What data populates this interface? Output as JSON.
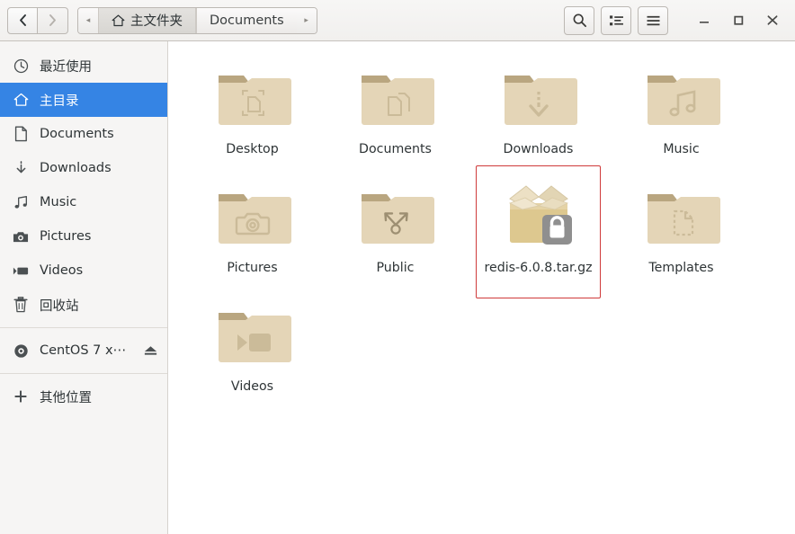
{
  "window": {
    "title": "Documents"
  },
  "header": {
    "nav": {
      "back_label": "‹",
      "back_name": "back-button",
      "forward_label": "›",
      "forward_name": "forward-button"
    },
    "breadcrumb": {
      "left_arrow": "◂",
      "right_arrow": "▸",
      "items": [
        {
          "label": "主文件夹",
          "icon": "home-icon",
          "active": true
        },
        {
          "label": "Documents",
          "icon": "",
          "active": false
        }
      ]
    },
    "tools": [
      {
        "name": "search-button",
        "icon": "search-icon",
        "label": ""
      },
      {
        "name": "view-list-button",
        "icon": "list-view-icon",
        "label": ""
      },
      {
        "name": "main-menu-button",
        "icon": "hamburger-icon",
        "label": ""
      }
    ],
    "window_controls": [
      {
        "name": "minimize-button",
        "icon": "minimize-icon",
        "label": "–"
      },
      {
        "name": "maximize-button",
        "icon": "maximize-icon",
        "label": "□"
      },
      {
        "name": "close-button",
        "icon": "close-icon",
        "label": "×"
      }
    ]
  },
  "sidebar": {
    "items": [
      {
        "label": "最近使用",
        "icon": "clock-icon",
        "name": "sidebar-item-recent",
        "selected": false,
        "eject": false
      },
      {
        "label": "主目录",
        "icon": "home-icon",
        "name": "sidebar-item-home",
        "selected": true,
        "eject": false
      },
      {
        "label": "Documents",
        "icon": "document-icon",
        "name": "sidebar-item-documents",
        "selected": false,
        "eject": false
      },
      {
        "label": "Downloads",
        "icon": "download-icon",
        "name": "sidebar-item-downloads",
        "selected": false,
        "eject": false
      },
      {
        "label": "Music",
        "icon": "music-icon",
        "name": "sidebar-item-music",
        "selected": false,
        "eject": false
      },
      {
        "label": "Pictures",
        "icon": "camera-icon",
        "name": "sidebar-item-pictures",
        "selected": false,
        "eject": false
      },
      {
        "label": "Videos",
        "icon": "video-icon",
        "name": "sidebar-item-videos",
        "selected": false,
        "eject": false
      },
      {
        "label": "回收站",
        "icon": "trash-icon",
        "name": "sidebar-item-trash",
        "selected": false,
        "eject": false
      },
      {
        "separator": true
      },
      {
        "label": "CentOS 7 x⋯",
        "icon": "disc-icon",
        "name": "sidebar-item-centos",
        "selected": false,
        "eject": true
      },
      {
        "separator": true
      },
      {
        "label": "其他位置",
        "icon": "plus-icon",
        "name": "sidebar-item-other-locations",
        "selected": false,
        "eject": false
      }
    ]
  },
  "main": {
    "files": [
      {
        "label": "Desktop",
        "icon": "folder-desktop-icon",
        "type": "folder",
        "selected": false
      },
      {
        "label": "Documents",
        "icon": "folder-documents-icon",
        "type": "folder",
        "selected": false
      },
      {
        "label": "Downloads",
        "icon": "folder-downloads-icon",
        "type": "folder",
        "selected": false
      },
      {
        "label": "Music",
        "icon": "folder-music-icon",
        "type": "folder",
        "selected": false
      },
      {
        "label": "Pictures",
        "icon": "folder-pictures-icon",
        "type": "folder",
        "selected": false
      },
      {
        "label": "Public",
        "icon": "folder-public-icon",
        "type": "folder",
        "selected": false
      },
      {
        "label": "redis-6.0.8.tar.gz",
        "icon": "archive-locked-icon",
        "type": "archive",
        "selected": true
      },
      {
        "label": "Templates",
        "icon": "folder-templates-icon",
        "type": "folder",
        "selected": false
      },
      {
        "label": "Videos",
        "icon": "folder-videos-icon",
        "type": "folder",
        "selected": false
      }
    ]
  },
  "colors": {
    "selection_blue": "#3584e4",
    "selection_outline_red": "#cf3a3a",
    "folder_tab": "#b9a680",
    "folder_body": "#e4d5b7",
    "archive_body": "#ddc88f",
    "archive_flap": "#ece0c4",
    "lock_badge": "#8f8f8f"
  }
}
